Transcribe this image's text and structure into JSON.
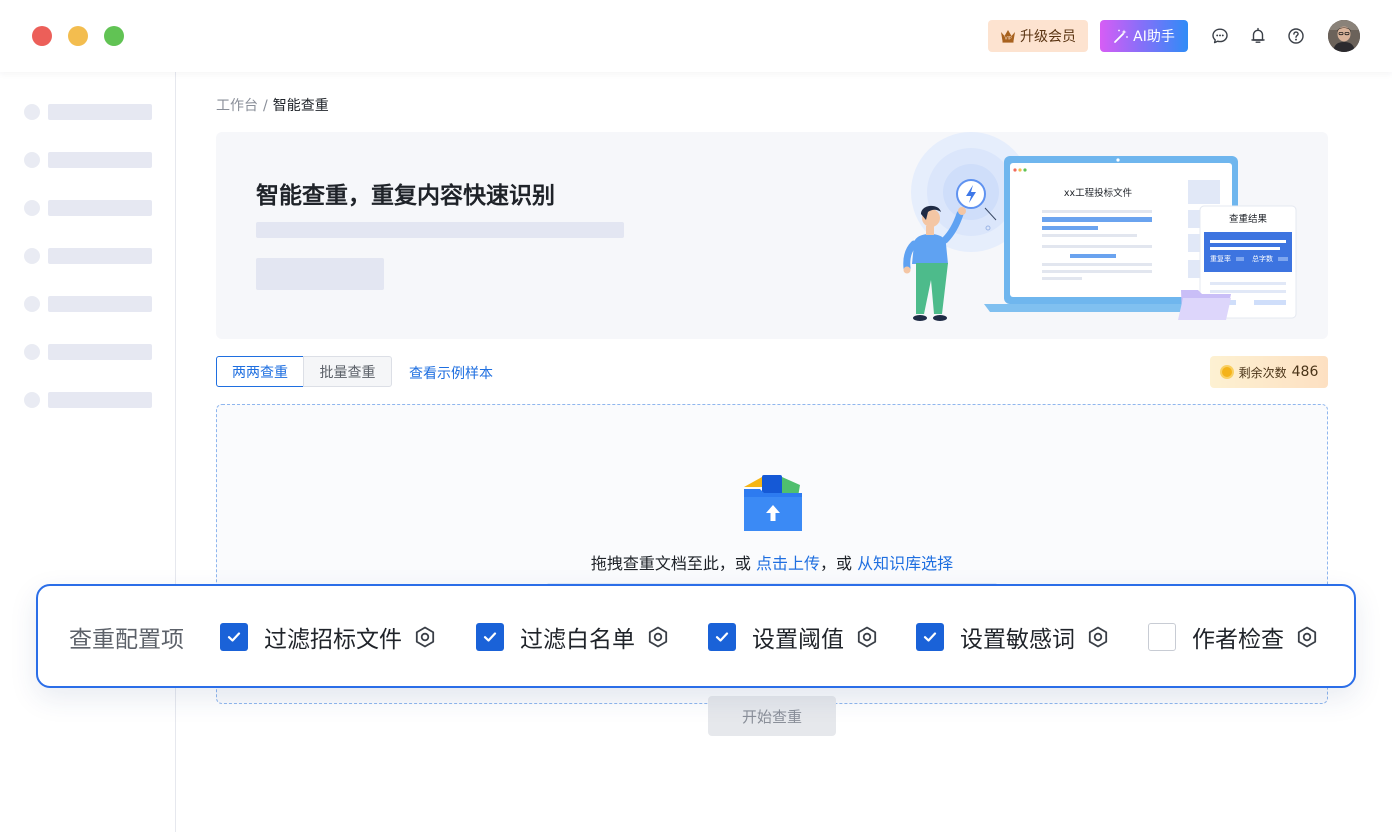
{
  "topbar": {
    "vip_label": "升级会员",
    "ai_label": "AI助手",
    "icons": [
      "chat-icon",
      "bell-icon",
      "help-icon"
    ]
  },
  "sidebar": {
    "item_count": 7
  },
  "breadcrumb": {
    "root": "工作台",
    "separator": "/",
    "current": "智能查重"
  },
  "banner": {
    "title": "智能查重，重复内容快速识别",
    "illustration": {
      "doc_title": "xx工程投标文件",
      "result_title": "查重结果",
      "result_repeat_label": "重复率",
      "result_words_label": "总字数"
    }
  },
  "tabs": [
    {
      "label": "两两查重",
      "active": true
    },
    {
      "label": "批量查重",
      "active": false
    }
  ],
  "sample_link": "查看示例样本",
  "remaining": {
    "label": "剩余次数",
    "count": "486"
  },
  "upload": {
    "prefix": "拖拽查重文档至此，或",
    "upload_link": "点击上传",
    "middle": "，或",
    "kb_link": "从知识库选择"
  },
  "start_button": "开始查重",
  "config": {
    "label": "查重配置项",
    "options": [
      {
        "label": "过滤招标文件",
        "checked": true
      },
      {
        "label": "过滤白名单",
        "checked": true
      },
      {
        "label": "设置阈值",
        "checked": true
      },
      {
        "label": "设置敏感词",
        "checked": true
      },
      {
        "label": "作者检查",
        "checked": false
      }
    ]
  },
  "colors": {
    "primary": "#1a62d8",
    "link": "#1f6fe0",
    "config_border": "#2b6ee8"
  }
}
